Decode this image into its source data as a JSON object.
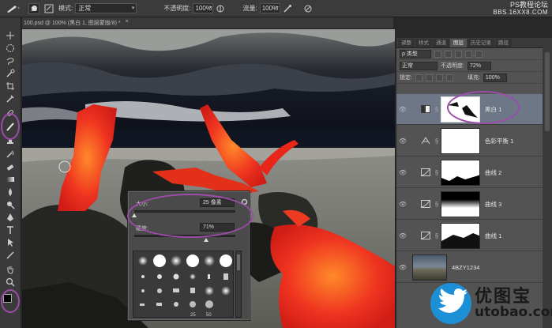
{
  "options_bar": {
    "brush_size": "25",
    "mode_label": "模式:",
    "mode_value": "正常",
    "opacity_label": "不透明度:",
    "opacity_value": "100%",
    "flow_label": "流量:",
    "flow_value": "100%"
  },
  "watermark": {
    "line1": "PS教程论坛",
    "line2": "BBS.16XX8.COM"
  },
  "document_tab": {
    "title": "100.psd @ 100% (黑白 1, 图层蒙版/8) *",
    "close": "×"
  },
  "layers_panel": {
    "tabs": [
      "调整",
      "样式",
      "通道",
      "图层",
      "历史记录",
      "路径"
    ],
    "active_tab": "图层",
    "filter_kind": "ρ 类型",
    "blend_mode": "正常",
    "opacity_label": "不透明度:",
    "opacity_value": "72%",
    "lock_label": "锁定:",
    "fill_label": "填充:",
    "fill_value": "100%",
    "layers": [
      {
        "name": "黑白 1",
        "adjustment": "blackwhite-icon",
        "selected": true
      },
      {
        "name": "色彩平衡 1",
        "adjustment": "balance-icon",
        "selected": false
      },
      {
        "name": "曲线 2",
        "adjustment": "curves-icon",
        "selected": false
      },
      {
        "name": "曲线 3",
        "adjustment": "curves-icon",
        "selected": false
      },
      {
        "name": "曲线 1",
        "adjustment": "curves-icon",
        "selected": false
      },
      {
        "name": "4BZY1234",
        "adjustment": "",
        "selected": false
      }
    ]
  },
  "brush_popup": {
    "size_label": "大小:",
    "size_value": "25 像素",
    "hardness_label": "硬度:",
    "hardness_value": "71%",
    "size_slider_fraction": 0.0,
    "hardness_slider_fraction": 0.71,
    "preset_numbers": [
      "25",
      "50"
    ]
  },
  "logo": {
    "chinese": "优图宝",
    "english": "utobao.com"
  },
  "colors": {
    "annotation_ring": "#9c4ca8",
    "selected_layer": "#6d7787",
    "lava": "#e8261a"
  }
}
